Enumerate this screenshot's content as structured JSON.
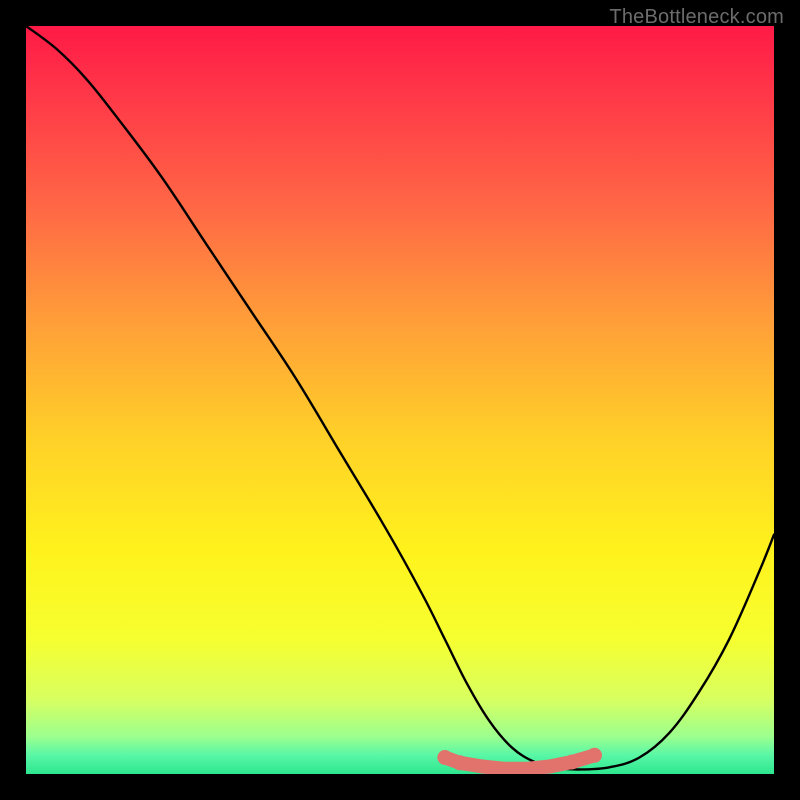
{
  "watermark": "TheBottleneck.com",
  "chart_data": {
    "type": "line",
    "title": "",
    "xlabel": "",
    "ylabel": "",
    "xlim": [
      0,
      100
    ],
    "ylim": [
      0,
      100
    ],
    "series": [
      {
        "name": "bottleneck-curve",
        "x": [
          0,
          4,
          8,
          12,
          18,
          24,
          30,
          36,
          42,
          48,
          53,
          56,
          59,
          62,
          65,
          68,
          71,
          74,
          78,
          82,
          86,
          90,
          94,
          98,
          100
        ],
        "y": [
          100,
          97,
          93,
          88,
          80,
          71,
          62,
          53,
          43,
          33,
          24,
          18,
          12,
          7,
          3.5,
          1.6,
          0.8,
          0.6,
          0.9,
          2.2,
          5.5,
          11,
          18,
          27,
          32
        ]
      },
      {
        "name": "green-floor-markers",
        "x": [
          56,
          58,
          61,
          64,
          67,
          70,
          73,
          76
        ],
        "y": [
          2.2,
          1.5,
          1.0,
          0.7,
          0.7,
          1.0,
          1.6,
          2.5
        ]
      }
    ],
    "gradient_stops": [
      {
        "offset": 0.0,
        "color": "#ff1a46"
      },
      {
        "offset": 0.1,
        "color": "#ff3a48"
      },
      {
        "offset": 0.25,
        "color": "#ff6a45"
      },
      {
        "offset": 0.4,
        "color": "#ffa038"
      },
      {
        "offset": 0.55,
        "color": "#ffd028"
      },
      {
        "offset": 0.7,
        "color": "#fff21c"
      },
      {
        "offset": 0.82,
        "color": "#f6ff30"
      },
      {
        "offset": 0.9,
        "color": "#d8ff60"
      },
      {
        "offset": 0.95,
        "color": "#9cff8e"
      },
      {
        "offset": 0.975,
        "color": "#58f7a6"
      },
      {
        "offset": 1.0,
        "color": "#2ee68f"
      }
    ],
    "marker_color": "#e2726c",
    "curve_color": "#000000"
  }
}
